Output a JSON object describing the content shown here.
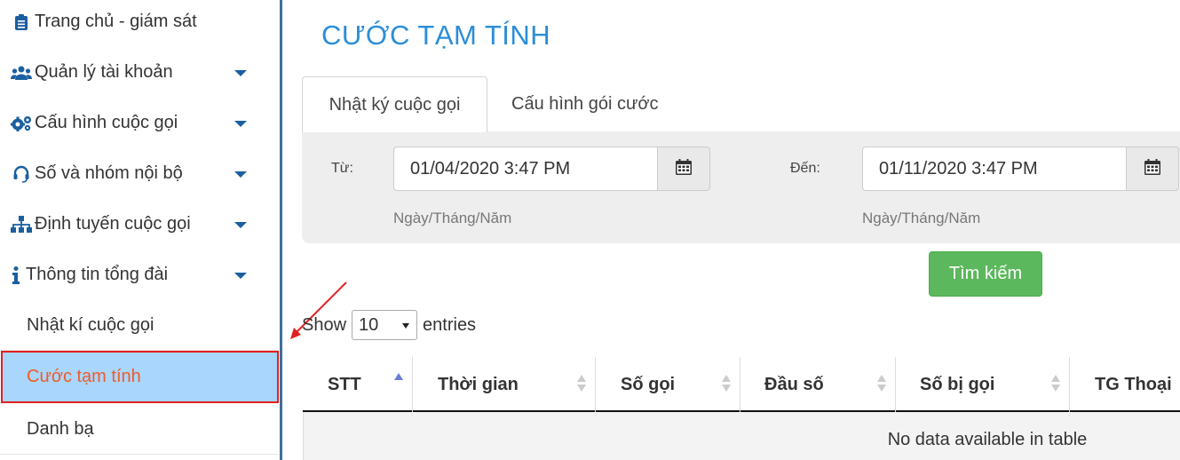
{
  "sidebar": {
    "items": [
      {
        "label": "Trang chủ - giám sát",
        "icon": "clipboard-icon",
        "has_caret": false
      },
      {
        "label": "Quản lý tài khoản",
        "icon": "users-icon",
        "has_caret": true
      },
      {
        "label": "Cấu hình cuộc gọi",
        "icon": "cogs-icon",
        "has_caret": true
      },
      {
        "label": "Số và nhóm nội bộ",
        "icon": "headset-icon",
        "has_caret": true
      },
      {
        "label": "Định tuyến cuộc gọi",
        "icon": "sitemap-icon",
        "has_caret": true
      },
      {
        "label": "Thông tin tổng đài",
        "icon": "info-icon",
        "has_caret": true
      }
    ],
    "subitems": [
      {
        "label": "Nhật kí cuộc gọi"
      },
      {
        "label": "Cước tạm tính",
        "active": true
      },
      {
        "label": "Danh bạ"
      }
    ]
  },
  "page": {
    "title": "CƯỚC TẠM TÍNH",
    "tabs": [
      {
        "label": "Nhật ký cuộc gọi",
        "active": true
      },
      {
        "label": "Cấu hình gói cước",
        "active": false
      }
    ]
  },
  "filter": {
    "from_label": "Từ:",
    "from_value": "01/04/2020 3:47 PM",
    "to_label": "Đến:",
    "to_value": "01/11/2020 3:47 PM",
    "date_hint": "Ngày/Tháng/Năm",
    "search_label": "Tìm kiếm"
  },
  "table_controls": {
    "show_label": "Show",
    "page_size": "10",
    "entries_label": "entries"
  },
  "table": {
    "columns": [
      "STT",
      "Thời gian",
      "Số gọi",
      "Đầu số",
      "Số bị gọi",
      "TG Thoại"
    ],
    "empty_message": "No data available in table"
  },
  "colors": {
    "title": "#2b8ed8",
    "active_bg": "#a8d6fc",
    "active_text": "#f05a28",
    "highlight_border": "#e02020",
    "search_button": "#5cb85c"
  }
}
